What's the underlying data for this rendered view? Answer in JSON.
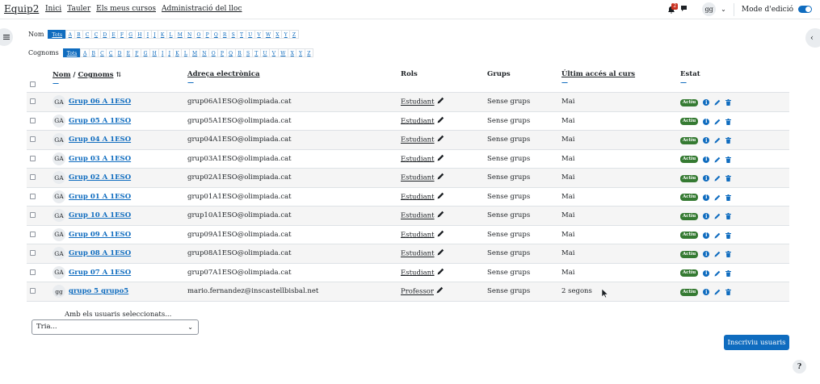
{
  "topbar": {
    "brand": "Equip2",
    "nav": [
      "Inici",
      "Tauler",
      "Els meus cursos",
      "Administració del lloc"
    ],
    "notification_count": "2",
    "user_initials": "gg",
    "edit_mode_label": "Mode d'edició"
  },
  "filters": {
    "nom_label": "Nom",
    "cognoms_label": "Cognoms",
    "all_label": "Tots",
    "letters": [
      "A",
      "B",
      "C",
      "Ç",
      "D",
      "E",
      "F",
      "G",
      "H",
      "I",
      "J",
      "K",
      "L",
      "M",
      "N",
      "O",
      "P",
      "Q",
      "R",
      "S",
      "T",
      "U",
      "V",
      "W",
      "X",
      "Y",
      "Z"
    ]
  },
  "table": {
    "headers": {
      "nom": "Nom",
      "sep": " / ",
      "cognoms": "Cognoms",
      "email": "Adreça electrònica",
      "rols": "Rols",
      "grups": "Grups",
      "ultim": "Últim accés al curs",
      "estat": "Estat",
      "dash": "—"
    },
    "status_label": "Actiu",
    "rows": [
      {
        "initials": "GA",
        "name": "Grup 06 A 1ESO",
        "email": "grup06A1ESO@olimpiada.cat",
        "role": "Estudiant",
        "groups": "Sense grups",
        "last": "Mai"
      },
      {
        "initials": "GA",
        "name": "Grup 05 A 1ESO",
        "email": "grup05A1ESO@olimpiada.cat",
        "role": "Estudiant",
        "groups": "Sense grups",
        "last": "Mai"
      },
      {
        "initials": "GA",
        "name": "Grup 04 A 1ESO",
        "email": "grup04A1ESO@olimpiada.cat",
        "role": "Estudiant",
        "groups": "Sense grups",
        "last": "Mai"
      },
      {
        "initials": "GA",
        "name": "Grup 03 A 1ESO",
        "email": "grup03A1ESO@olimpiada.cat",
        "role": "Estudiant",
        "groups": "Sense grups",
        "last": "Mai"
      },
      {
        "initials": "GA",
        "name": "Grup 02 A 1ESO",
        "email": "grup02A1ESO@olimpiada.cat",
        "role": "Estudiant",
        "groups": "Sense grups",
        "last": "Mai"
      },
      {
        "initials": "GA",
        "name": "Grup 01 A 1ESO",
        "email": "grup01A1ESO@olimpiada.cat",
        "role": "Estudiant",
        "groups": "Sense grups",
        "last": "Mai"
      },
      {
        "initials": "GA",
        "name": "Grup 10 A 1ESO",
        "email": "grup10A1ESO@olimpiada.cat",
        "role": "Estudiant",
        "groups": "Sense grups",
        "last": "Mai"
      },
      {
        "initials": "GA",
        "name": "Grup 09 A 1ESO",
        "email": "grup09A1ESO@olimpiada.cat",
        "role": "Estudiant",
        "groups": "Sense grups",
        "last": "Mai"
      },
      {
        "initials": "GA",
        "name": "Grup 08 A 1ESO",
        "email": "grup08A1ESO@olimpiada.cat",
        "role": "Estudiant",
        "groups": "Sense grups",
        "last": "Mai"
      },
      {
        "initials": "GA",
        "name": "Grup 07 A 1ESO",
        "email": "grup07A1ESO@olimpiada.cat",
        "role": "Estudiant",
        "groups": "Sense grups",
        "last": "Mai"
      },
      {
        "initials": "gg",
        "name": "grupo 5 grupo5",
        "email": "mario.fernandez@inscastellbisbal.net",
        "role": "Professor",
        "groups": "Sense grups",
        "last": "2 segons"
      }
    ]
  },
  "bulk": {
    "label": "Amb els usuaris seleccionats...",
    "selected": "Tria..."
  },
  "enrol_button": "Inscriviu usuaris",
  "help_label": "?",
  "colors": {
    "primary": "#0f6cbf",
    "active_badge": "#357a32",
    "notification_badge": "#ca3120"
  }
}
